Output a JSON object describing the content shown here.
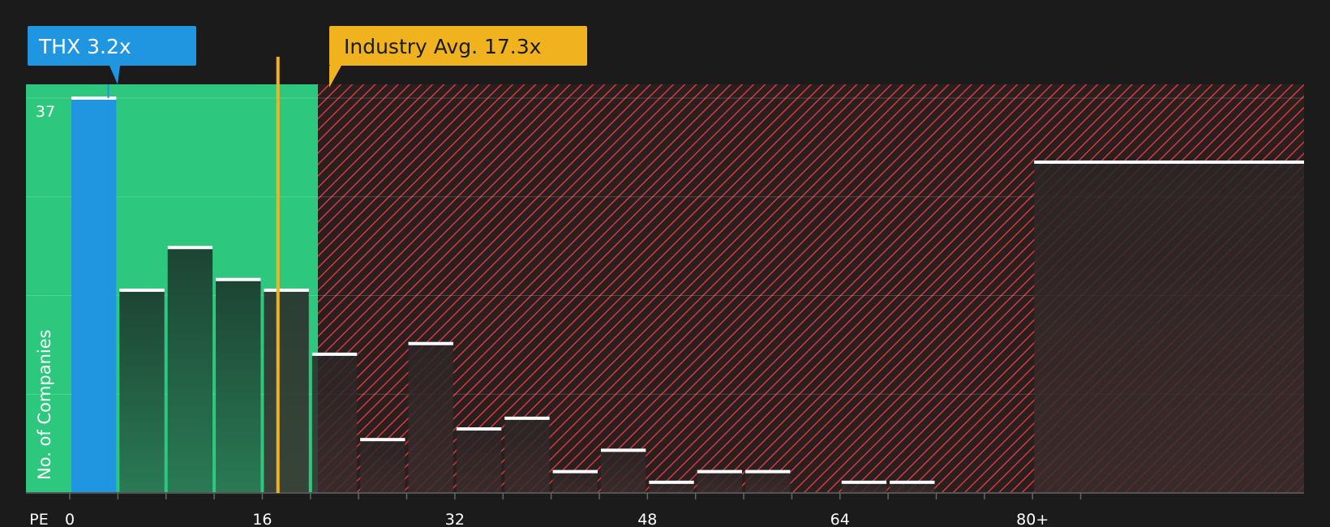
{
  "chart_data": {
    "type": "bar",
    "xlabel": "PE",
    "ylabel": "No. of Companies",
    "y_top_label": "37",
    "ylim": [
      0,
      37
    ],
    "bin_width": 4,
    "x_ticks": [
      {
        "value": 0,
        "label": "0"
      },
      {
        "value": 16,
        "label": "16"
      },
      {
        "value": 32,
        "label": "32"
      },
      {
        "value": 48,
        "label": "48"
      },
      {
        "value": 64,
        "label": "64"
      },
      {
        "value": 80,
        "label": "80+"
      }
    ],
    "bins": [
      {
        "start": 0,
        "value": 37,
        "highlight": true
      },
      {
        "start": 4,
        "value": 19
      },
      {
        "start": 8,
        "value": 23
      },
      {
        "start": 12,
        "value": 20
      },
      {
        "start": 16,
        "value": 19
      },
      {
        "start": 20,
        "value": 13
      },
      {
        "start": 24,
        "value": 5
      },
      {
        "start": 28,
        "value": 14
      },
      {
        "start": 32,
        "value": 6
      },
      {
        "start": 36,
        "value": 7
      },
      {
        "start": 40,
        "value": 2
      },
      {
        "start": 44,
        "value": 4
      },
      {
        "start": 48,
        "value": 1
      },
      {
        "start": 52,
        "value": 2
      },
      {
        "start": 56,
        "value": 2
      },
      {
        "start": 60,
        "value": 0
      },
      {
        "start": 64,
        "value": 1
      },
      {
        "start": 68,
        "value": 1
      },
      {
        "start": 72,
        "value": 0
      },
      {
        "start": 76,
        "value": 0
      },
      {
        "start": 80,
        "value": 31
      }
    ],
    "company": {
      "label": "THX 3.2x",
      "value": 3.2
    },
    "industry": {
      "label": "Industry Avg. 17.3x",
      "value": 17.3
    },
    "colors": {
      "background": "#1b1b1b",
      "good_zone": "#2dc87e",
      "bad_zone_stripe": "#d63a3a",
      "company": "#2196e0",
      "industry": "#f0b21e",
      "bar_in_good": "#1f4a38",
      "bar_in_bad": "#3a2a2a",
      "cap": "#ffffff"
    },
    "grid": true
  }
}
